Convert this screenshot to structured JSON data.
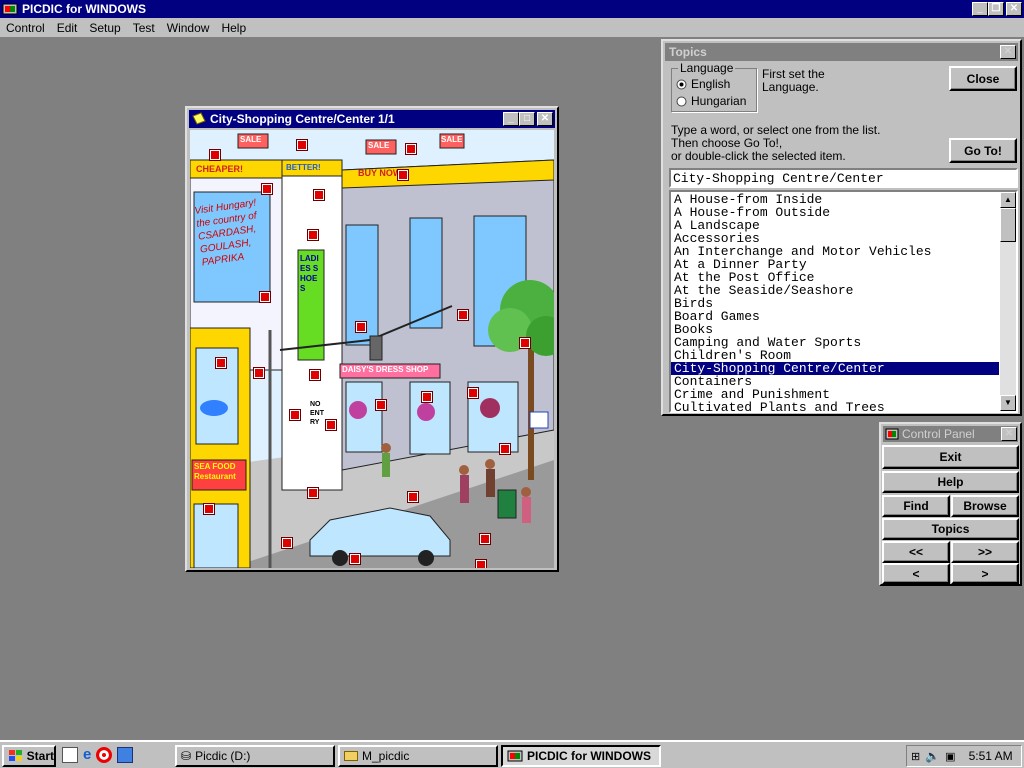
{
  "app": {
    "title": "PICDIC for WINDOWS",
    "menu": [
      "Control",
      "Edit",
      "Setup",
      "Test",
      "Window",
      "Help"
    ]
  },
  "picture_window": {
    "title": "City-Shopping Centre/Center 1/1",
    "signs": {
      "sale": "SALE",
      "cheaper": "CHEAPER!",
      "better": "BETTER!",
      "buy_now": "BUY NOW!",
      "visit": "Visit Hungary! the country of CSARDASH, GOULASH, PAPRIKA",
      "ladies_shoes": "LADIES SHOES",
      "dress_shop": "DAISY'S DRESS SHOP",
      "no_entry": "NO ENTRY",
      "sea_food": "SEA FOOD Restaurant"
    }
  },
  "topics": {
    "title": "Topics",
    "language_label": "Language",
    "languages": [
      "English",
      "Hungarian"
    ],
    "selected_language": "English",
    "hint_language": "First set the Language.",
    "close_label": "Close",
    "instructions": [
      "Type a word, or select one from the list.",
      "Then choose Go To!,",
      "or double-click the selected item."
    ],
    "goto_label": "Go To!",
    "search_value": "City-Shopping Centre/Center",
    "items": [
      "A House-from Inside",
      "A House-from Outside",
      "A Landscape",
      "Accessories",
      "An Interchange and Motor Vehicles",
      "At a Dinner Party",
      "At the Post Office",
      "At the Seaside/Seashore",
      "Birds",
      "Board Games",
      "Books",
      "Camping and Water Sports",
      "Children's Room",
      "City-Shopping Centre/Center",
      "Containers",
      "Crime and Punishment",
      "Cultivated Plants and Trees"
    ],
    "selected_item": "City-Shopping Centre/Center"
  },
  "control_panel": {
    "title": "Control Panel",
    "exit": "Exit",
    "help": "Help",
    "find": "Find",
    "browse": "Browse",
    "topics": "Topics",
    "first": "<<",
    "last": ">>",
    "prev": "<",
    "next": ">"
  },
  "taskbar": {
    "start": "Start",
    "tasks": [
      {
        "label": "Picdic (D:)",
        "active": false
      },
      {
        "label": "M_picdic",
        "active": false
      },
      {
        "label": "PICDIC for WINDOWS",
        "active": true
      }
    ],
    "clock": "5:51 AM"
  },
  "colors": {
    "titlebar_active": "#000080",
    "titlebar_inactive": "#808080",
    "desktop": "#808080",
    "face": "#c0c0c0",
    "hotspot": "#e00000"
  }
}
